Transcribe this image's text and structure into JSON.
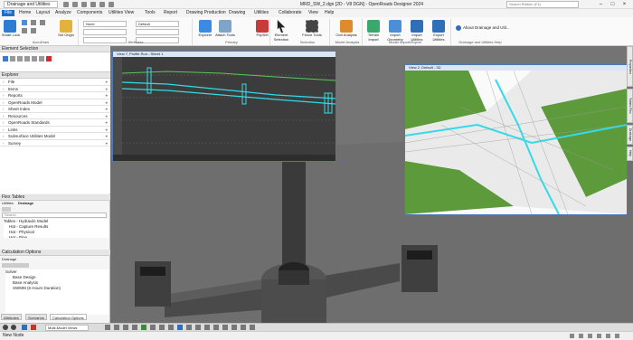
{
  "titlebar": {
    "workspace": "Drainage and Utilities",
    "window_title": "MRD_SW_2.dgn [2D - V8 DGN] - OpenRoads Designer 2024",
    "search_placeholder": "Search Ribbon (F4)"
  },
  "menu": [
    "File",
    "Home",
    "Layout",
    "Analyze",
    "Components",
    "Utilities View",
    "Tools",
    "Report",
    "Drawing Production",
    "Drawing",
    "Utilities",
    "Collaborate",
    "View",
    "Help"
  ],
  "ribbon": {
    "groups": [
      "AccuDraw",
      "Attributes",
      "Primary",
      "Selection",
      "Model Analysis",
      "Model Import/Export",
      "Drainage and Utilities Help"
    ],
    "buttons": {
      "smart_lock": "Smart Lock",
      "set_origin": "Set Origin",
      "explorer": "Explorer",
      "attach_tools": "Attach Tools",
      "popset": "PopSet",
      "element_selection": "Element Selection",
      "fence_tools": "Fence Tools",
      "civil_analysis": "Civil Analysis",
      "terrain_import": "Terrain Import",
      "import_geometry": "Import Geometry",
      "import_utilities": "Import Utilities",
      "export_utilities": "Export Utilities",
      "about": "About Drainage and Util..."
    },
    "attr_level": "None",
    "attr_style": "Default"
  },
  "left_panel": {
    "element_selection_title": "Element Selection",
    "explorer_title": "Explorer",
    "explorer_items": [
      "File",
      "Items",
      "Reports",
      "OpenRoads Model",
      "Sheet Index",
      "Resources",
      "OpenRoads Standards",
      "Links",
      "Subsurface Utilities Model",
      "Survey"
    ],
    "flextables_title": "Flex Tables",
    "flextables_tabs": [
      "Utilities",
      "Drainage"
    ],
    "flextables_search": "Search",
    "flextables_tree": [
      "Tables - Hydraulic Model",
      "Hat - Capture Results",
      "Hat - Physical",
      "Hat - Pipe"
    ],
    "calc_title": "Calculation Options",
    "calc_subtitle": "Drainage",
    "calc_tree": [
      "Solver",
      "Base Design",
      "Base Analysis",
      "SWMM (6 Hours Duration)"
    ],
    "bottom_tabs": [
      "Attributes",
      "Scenarios",
      "Calculation Options"
    ]
  },
  "views": {
    "profile_title": "View 7, Profile Run - Sheet 1",
    "view3d_title": "View 2, Default - 3D"
  },
  "toolbar2": {
    "model_select": "Multi-Model Views"
  },
  "status": {
    "message": "New Node"
  },
  "right_tabs": [
    "Properties",
    "Tables Flex",
    "Drainage",
    "Help"
  ]
}
